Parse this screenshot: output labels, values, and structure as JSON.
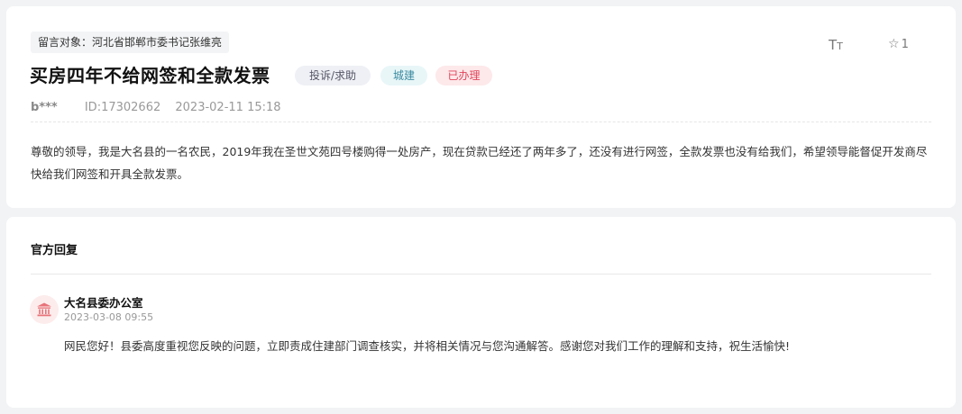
{
  "message": {
    "target_tag": "留言对象：河北省邯郸市委书记张维亮",
    "title": "买房四年不给网签和全款发票",
    "type_tag": "投诉/求助",
    "category_tag": "城建",
    "status_tag": "已办理",
    "font_toggle": "TT",
    "favorite_count": "1",
    "user": "b***",
    "id_text": "ID:17302662",
    "datetime": "2023-02-11 15:18",
    "content": "尊敬的领导，我是大名县的一名农民，2019年我在圣世文苑四号楼购得一处房产，现在贷款已经还了两年多了，还没有进行网签，全款发票也没有给我们，希望领导能督促开发商尽快给我们网签和开具全款发票。"
  },
  "reply": {
    "section_title": "官方回复",
    "department": "大名县委办公室",
    "datetime": "2023-03-08 09:55",
    "content": "网民您好！县委高度重视您反映的问题，立即责成住建部门调查核实，并将相关情况与您沟通解答。感谢您对我们工作的理解和支持，祝生活愉快!"
  },
  "icons": {
    "font_size": "font-size-icon",
    "favorite": "star-outline-icon",
    "department": "government-building-icon"
  },
  "colors": {
    "status_red": "#e0445a",
    "category_teal": "#3a8aa0",
    "avatar_bg": "#fdecec",
    "avatar_icon": "#e8737a"
  }
}
